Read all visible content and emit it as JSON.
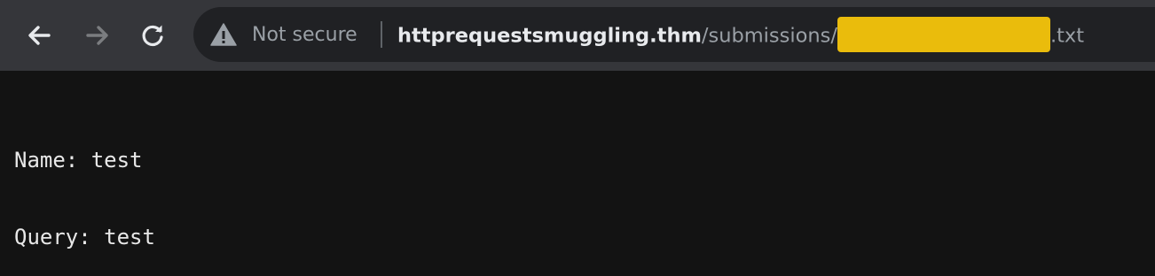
{
  "browser": {
    "nav": {
      "back_icon": "arrow-left-icon",
      "forward_icon": "arrow-right-icon",
      "reload_icon": "reload-icon"
    },
    "omnibox": {
      "security_icon": "warning-triangle-icon",
      "security_label": "Not secure",
      "url_host": "httprequestsmuggling.thm",
      "url_path": "/submissions/",
      "url_suffix": ".txt",
      "redaction_color": "#eabc0c"
    }
  },
  "page": {
    "lines": [
      "Name: test",
      "Query: test"
    ]
  },
  "colors": {
    "toolbar_bg": "#35363a",
    "omnibox_bg": "#202124",
    "page_bg": "#131313",
    "text": "#e8e8e8"
  }
}
